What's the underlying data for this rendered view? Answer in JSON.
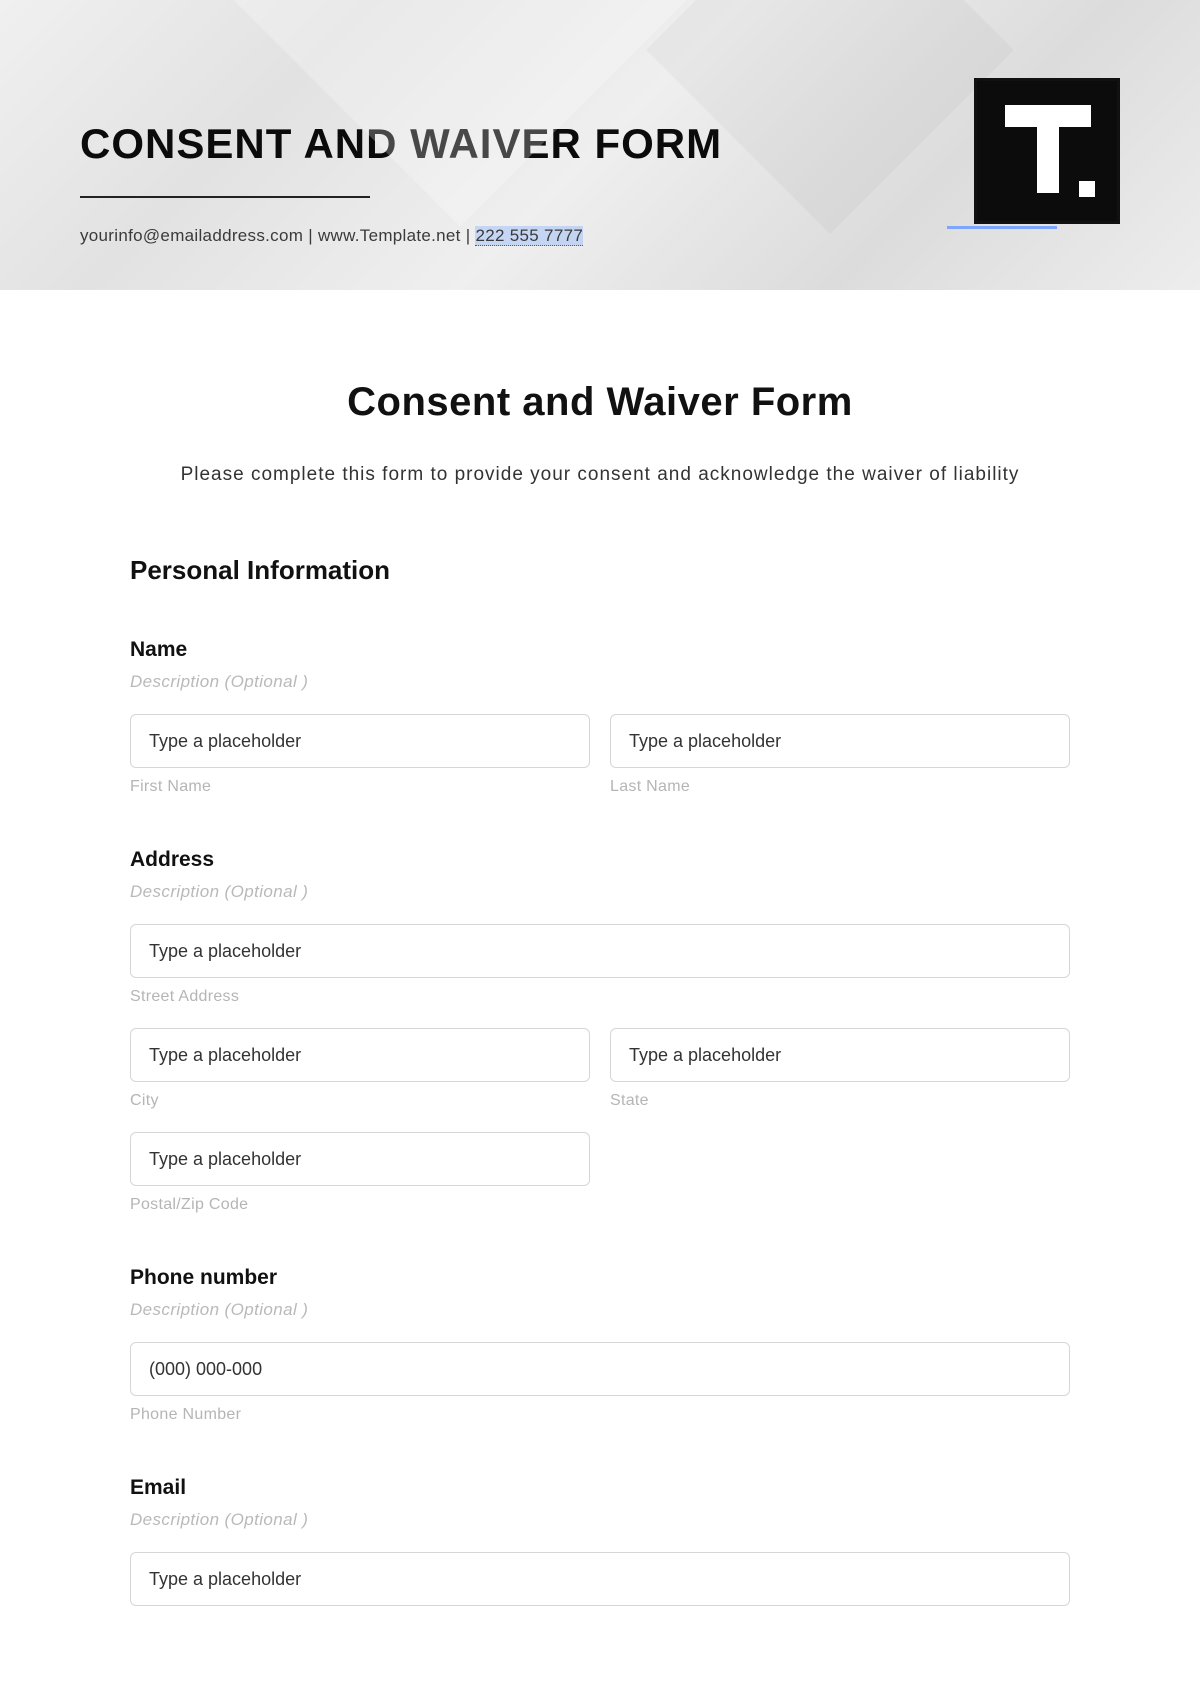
{
  "banner": {
    "title": "CONSENT AND WAIVER FORM",
    "email": "yourinfo@emailaddress.com",
    "sep": "  |  ",
    "website": "www.Template.net",
    "phone": "222 555 7777"
  },
  "form": {
    "title": "Consent and Waiver Form",
    "subtitle": "Please complete this form to provide your consent and acknowledge the waiver of liability",
    "section1": "Personal Information",
    "desc_optional": "Description  (Optional )",
    "placeholder_generic": "Type a placeholder",
    "name": {
      "label": "Name",
      "first_sub": "First Name",
      "last_sub": "Last Name"
    },
    "address": {
      "label": "Address",
      "street_sub": "Street Address",
      "city_sub": "City",
      "state_sub": "State",
      "postal_sub": "Postal/Zip Code"
    },
    "phone": {
      "label": "Phone number",
      "placeholder": "(000) 000-000",
      "sub": "Phone Number"
    },
    "email": {
      "label": "Email"
    }
  }
}
